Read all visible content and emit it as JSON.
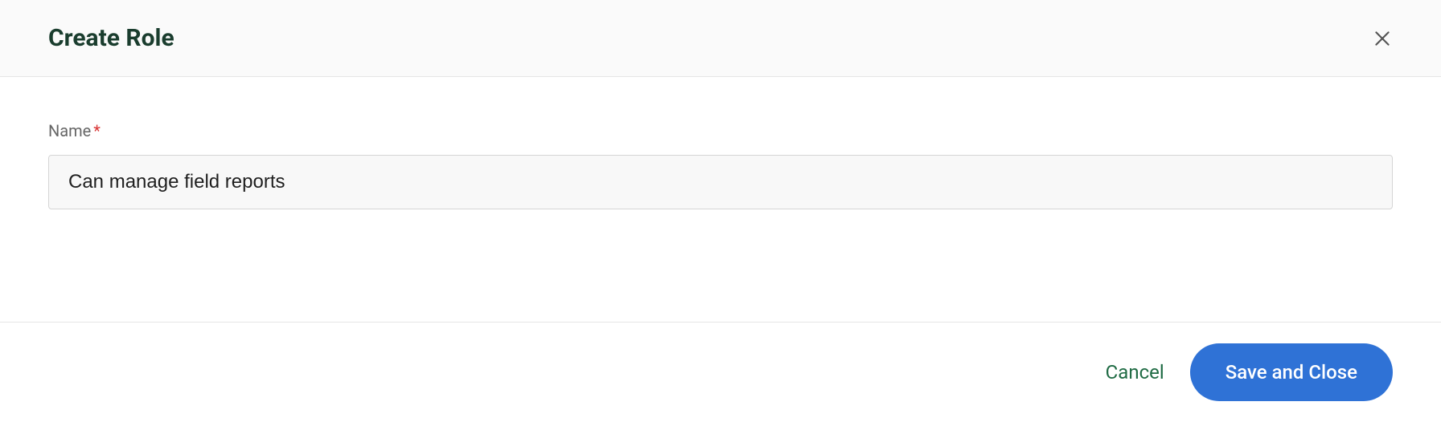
{
  "header": {
    "title": "Create Role"
  },
  "form": {
    "name_label": "Name",
    "required_marker": "*",
    "name_value": "Can manage field reports"
  },
  "footer": {
    "cancel_label": "Cancel",
    "save_label": "Save and Close"
  }
}
